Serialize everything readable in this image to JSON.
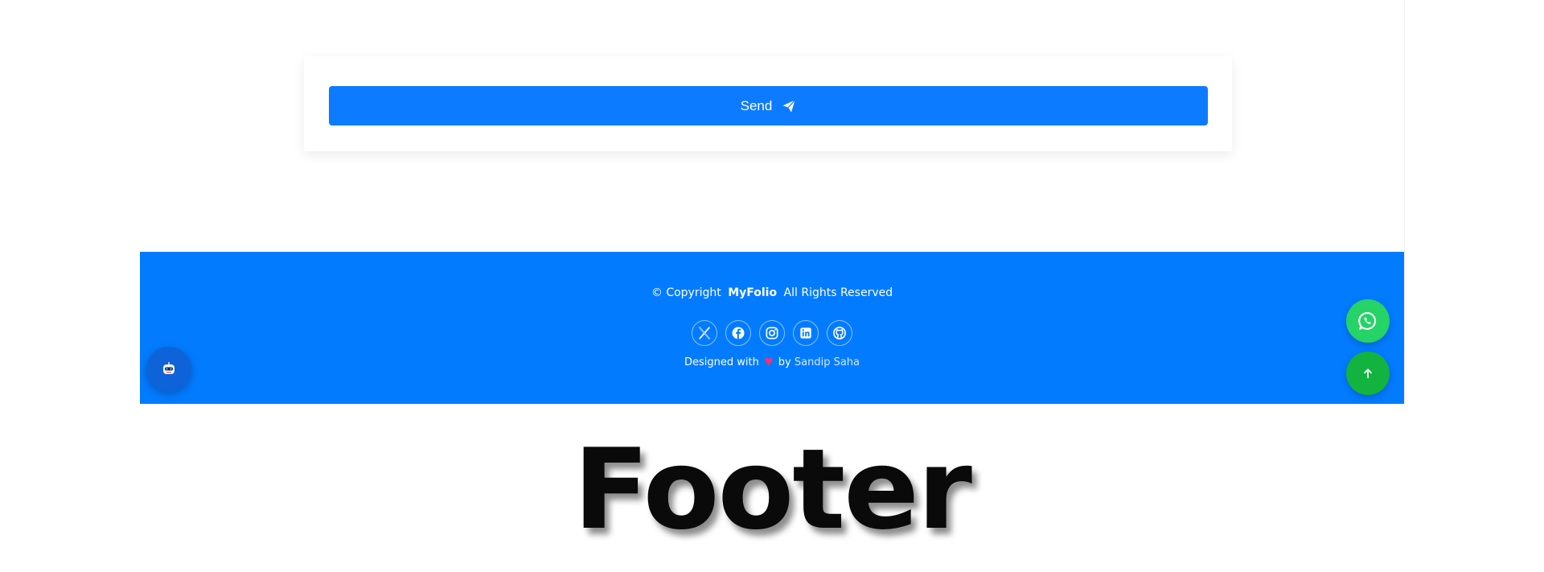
{
  "contact_form": {
    "send_label": "Send",
    "send_icon": "paper-plane-icon"
  },
  "footer": {
    "background": "#037bff",
    "copyright_prefix": "© Copyright",
    "brand": "MyFolio",
    "rights": "All Rights Reserved",
    "socials": [
      {
        "name": "x-twitter",
        "icon": "x-icon"
      },
      {
        "name": "facebook",
        "icon": "facebook-icon"
      },
      {
        "name": "instagram",
        "icon": "instagram-icon"
      },
      {
        "name": "linkedin",
        "icon": "linkedin-icon"
      },
      {
        "name": "github",
        "icon": "github-icon"
      }
    ],
    "designed_prefix": "Designed with",
    "designed_by": "by",
    "author": "Sandip Saha"
  },
  "floating": {
    "chatbot_icon": "robot-icon",
    "whatsapp_icon": "whatsapp-icon",
    "back_to_top_icon": "arrow-up-icon"
  },
  "caption": "Footer",
  "colors": {
    "primary_blue": "#0d7bff",
    "whatsapp_green": "#25d366",
    "top_green": "#13b33f",
    "heart": "#ff2d6b"
  }
}
